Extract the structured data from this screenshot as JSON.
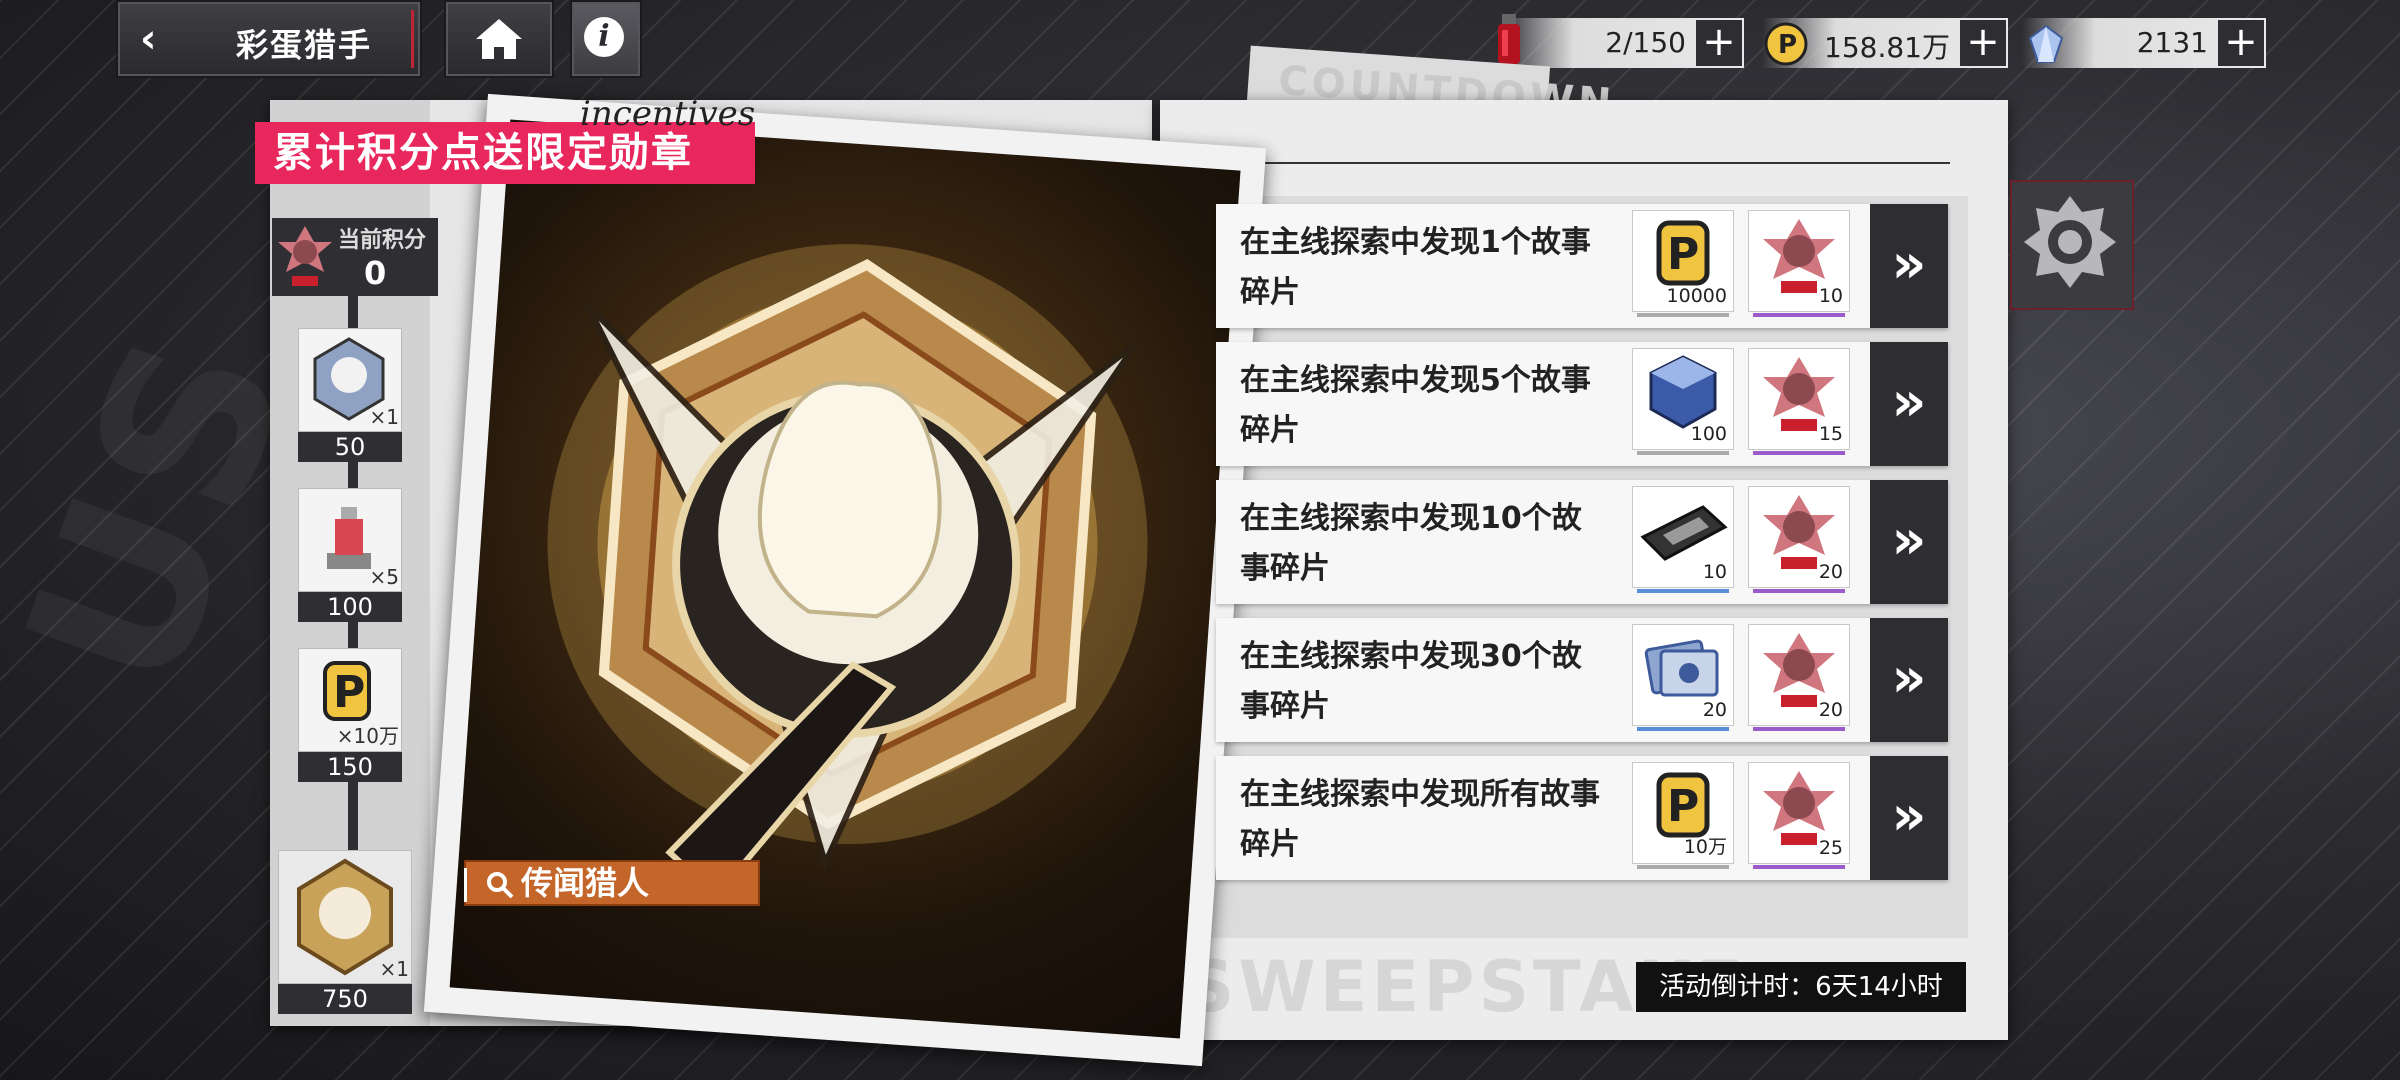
{
  "header": {
    "back_arrow": "‹",
    "title": "彩蛋猎手",
    "info": "i"
  },
  "resources": [
    {
      "icon": "stamina-vial-icon",
      "value": "2/150"
    },
    {
      "icon": "p-coin-icon",
      "value": "158.81万"
    },
    {
      "icon": "crystal-icon",
      "value": "2131"
    }
  ],
  "left_panel": {
    "banner": "累计积分点送限定勋章",
    "incentive": "incentives",
    "current_points_label": "当前积分",
    "current_points": "0",
    "milestones": [
      {
        "qty": "×1",
        "points": "50"
      },
      {
        "qty": "×5",
        "points": "100"
      },
      {
        "qty": "×10万",
        "points": "150"
      }
    ],
    "final_milestone": {
      "qty": "×1",
      "points": "750"
    },
    "medal_name": "传闻猎人"
  },
  "right_panel": {
    "back_text": "COUNTDOWN",
    "watermark": "SWEEPSTAKE",
    "tasks": [
      {
        "desc": "在主线探索中发现1个故事碎片",
        "reward1": "10000",
        "reward1_icon": "p-coin-icon",
        "reward2": "10",
        "reward2_icon": "medal-point-icon"
      },
      {
        "desc": "在主线探索中发现5个故事碎片",
        "reward1": "100",
        "reward1_icon": "crystal-cube-icon",
        "reward2": "15",
        "reward2_icon": "medal-point-icon"
      },
      {
        "desc": "在主线探索中发现10个故事碎片",
        "reward1": "10",
        "reward1_icon": "chip-card-icon",
        "reward2": "20",
        "reward2_icon": "medal-point-icon"
      },
      {
        "desc": "在主线探索中发现30个故事碎片",
        "reward1": "20",
        "reward1_icon": "ticket-stack-icon",
        "reward2": "20",
        "reward2_icon": "medal-point-icon"
      },
      {
        "desc": "在主线探索中发现所有故事碎片",
        "reward1": "10万",
        "reward1_icon": "p-coin-icon",
        "reward2": "25",
        "reward2_icon": "medal-point-icon"
      }
    ],
    "go_label": "»",
    "countdown": "活动倒计时：6天14小时"
  },
  "colors": {
    "accent_pink": "#e8285c",
    "dark_panel": "#2e2e32",
    "medal_gold": "#c9a25a",
    "tag_orange": "#c4662a",
    "rarity_blue": "#5a8fd8",
    "rarity_purple": "#9a5cc8"
  }
}
